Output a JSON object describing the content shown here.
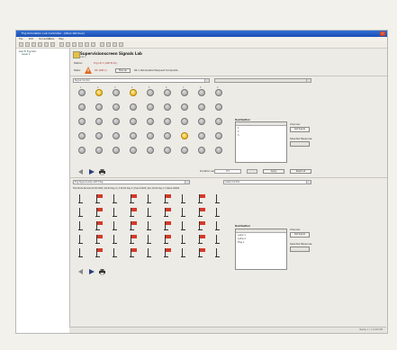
{
  "window": {
    "title": "Fog Simulation Lab Controller - [Main Window]",
    "close_label": "x"
  },
  "menu": [
    "File",
    "Edit",
    "Simulation",
    "Tools",
    "Help"
  ],
  "tree": [
    "Sub-Fi Fog Sim.",
    "Level 1"
  ],
  "header": {
    "title": "Supervisionscreen Signals Lab",
    "subtitle": "Lab 1"
  },
  "info": {
    "station_label": "Station:",
    "station_value": "Fog UP 1 (SIM B 24)",
    "state_label": "State:",
    "state_value": "OK (SIM 1)",
    "state_button": "Manual",
    "state_desc": "SR 1 Abbreviated Request Composite"
  },
  "top_section": {
    "selector": "Signal Control",
    "selector_right": "",
    "column_numbers": [
      "1",
      "2",
      "3",
      "4",
      "5",
      "6",
      "7",
      "8",
      "9"
    ],
    "rows": [
      [
        0,
        1,
        0,
        1,
        0,
        0,
        0,
        0,
        0
      ],
      [
        0,
        0,
        0,
        0,
        0,
        0,
        0,
        0,
        0
      ],
      [
        0,
        0,
        0,
        0,
        0,
        0,
        0,
        0,
        0
      ],
      [
        0,
        0,
        0,
        0,
        0,
        0,
        1,
        0,
        0
      ],
      [
        0,
        0,
        0,
        0,
        0,
        0,
        0,
        0,
        0
      ]
    ],
    "destination_label": "Destination",
    "destination_items": [
      "1",
      "2",
      "3"
    ],
    "side_label": "Channel:",
    "side_button": "Set Signal",
    "side_label2": "Selected Response",
    "side_button2": "",
    "bottom_label": "Duration sec.",
    "bottom_value": "0.5",
    "bottom_btn1": "Apply",
    "bottom_btn2": "Reset all"
  },
  "bottom_section": {
    "selector": "Fog Signal Lamp with Flag",
    "selector_right": "Lamp Control",
    "status_line": "FOG Mode Normal  00 00 0000 | 00:00 Day 0 | 0 00:00 Day 0 | Event 0005 | Run 00:00 Day 0 | Status 00000",
    "rows": 5,
    "cols": 9,
    "destination_label": "Destination",
    "destination_items": [
      "Lamp 1",
      "Lamp 2",
      "Flag 1"
    ],
    "side_label": "Channel:",
    "side_button": "Set Signal",
    "side_label2": "Selected Response",
    "side_button2": ""
  },
  "statusbar": "Ready  1 / 1  12:00 PM",
  "colors": {
    "titlebar": "#1c4fb3",
    "bulb_on": "#e0a400",
    "flag": "#d43a2a"
  }
}
